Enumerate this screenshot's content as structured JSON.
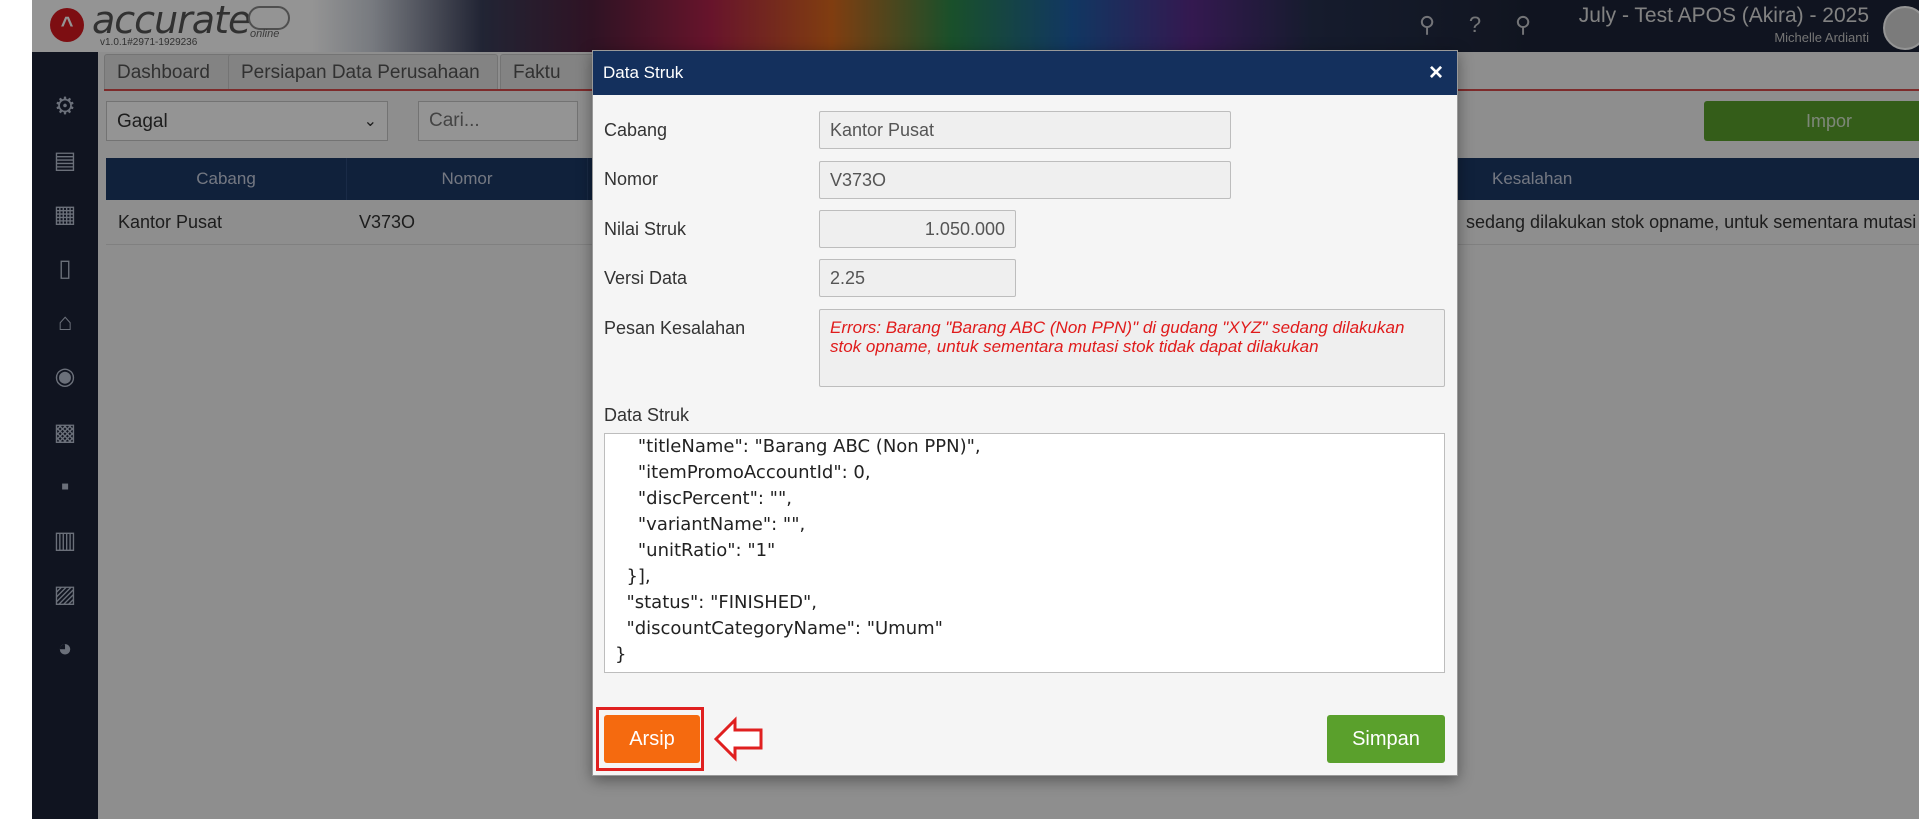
{
  "header": {
    "logo_text": "accurate",
    "logo_online": "online",
    "version": "v1.0.1#2971-1929236",
    "company": "July - Test APOS (Akira) - 2025",
    "user": "Michelle Ardianti"
  },
  "tabs": [
    "Dashboard",
    "Persiapan Data Perusahaan",
    "Faktu"
  ],
  "toolbar": {
    "status_select": "Gagal",
    "search_placeholder": "Cari...",
    "import_label": "Impor"
  },
  "grid": {
    "columns": [
      "Cabang",
      "Nomor",
      "Kesalahan"
    ],
    "rows": [
      {
        "cabang": "Kantor Pusat",
        "nomor": "V373O",
        "kesalahan": "sedang dilakukan stok opname, untuk sementara mutasi st..."
      }
    ]
  },
  "modal": {
    "title": "Data Struk",
    "close_glyph": "×",
    "fields": {
      "cabang_label": "Cabang",
      "cabang_value": "Kantor Pusat",
      "nomor_label": "Nomor",
      "nomor_value": "V373O",
      "nilai_label": "Nilai Struk",
      "nilai_value": "1.050.000",
      "versi_label": "Versi Data",
      "versi_value": "2.25",
      "pesan_label": "Pesan Kesalahan",
      "pesan_value": "Errors: Barang \"Barang ABC (Non PPN)\" di gudang \"XYZ\" sedang dilakukan stok opname, untuk sementara mutasi stok tidak dapat dilakukan",
      "data_label": "Data Struk"
    },
    "json_lines": [
      "    \"titleName\": \"Barang ABC (Non PPN)\",",
      "    \"itemPromoAccountId\": 0,",
      "    \"discPercent\": \"\",",
      "    \"variantName\": \"\",",
      "    \"unitRatio\": \"1\"",
      "  }],",
      "  \"status\": \"FINISHED\",",
      "  \"discountCategoryName\": \"Umum\"",
      "}"
    ],
    "arsip_label": "Arsip",
    "simpan_label": "Simpan"
  },
  "colors": {
    "sidebar": "#1d2437",
    "modal_header": "#14305d",
    "grid_header": "#1d3a66",
    "arsip": "#f56a0f",
    "simpan": "#5aa02c",
    "highlight": "#e02020",
    "error_text": "#e01b1b"
  },
  "icons": {
    "sidebar": [
      "gear-icon",
      "cash-register-icon",
      "building-icon",
      "book-icon",
      "bank-icon",
      "money-bag-icon",
      "cart-icon",
      "trolley-icon",
      "factory-icon",
      "tax-icon",
      "report-icon"
    ],
    "header": [
      "search-icon",
      "help-icon",
      "bell-icon"
    ]
  }
}
